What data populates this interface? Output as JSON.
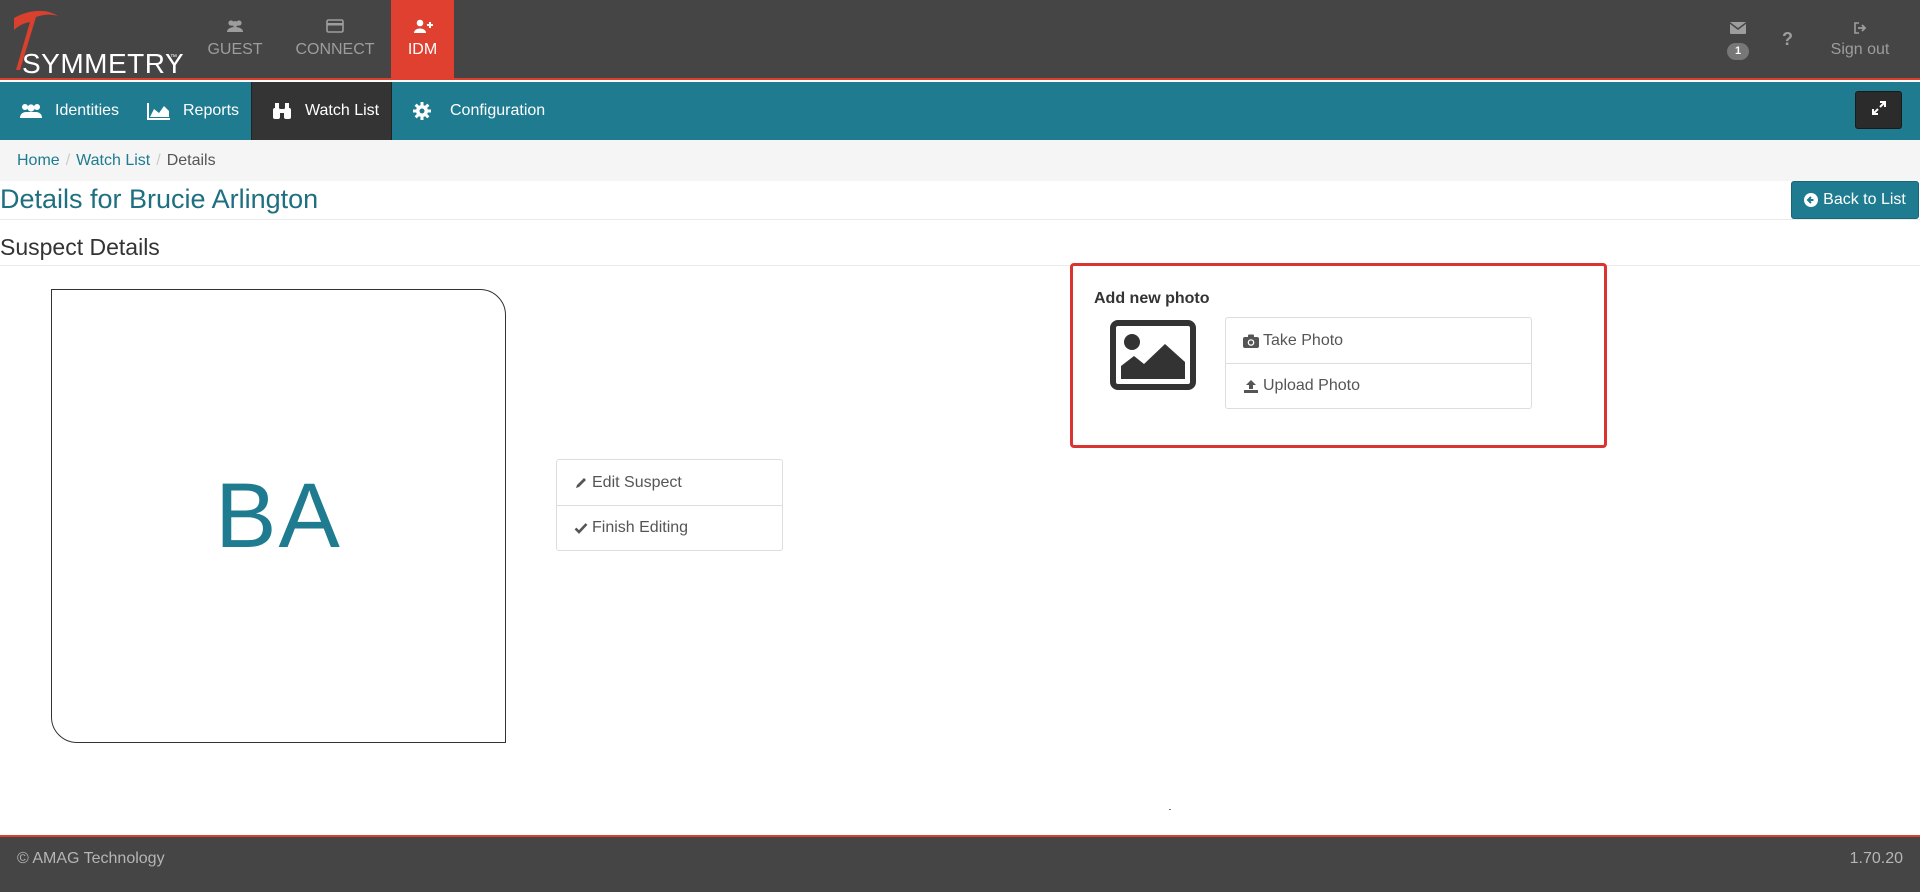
{
  "brand": {
    "logo_text": "SYMMETRY",
    "trademark": "™",
    "accent_color": "#1e7b90",
    "active_module_color": "#e0402f"
  },
  "modules": [
    {
      "label": "GUEST",
      "icon": "users-icon"
    },
    {
      "label": "CONNECT",
      "icon": "card-icon"
    },
    {
      "label": "IDM",
      "icon": "user-plus-icon",
      "active": true
    }
  ],
  "top_right": {
    "messages_icon": "envelope-icon",
    "message_count": "1",
    "help_icon": "question-icon",
    "sign_out_label": "Sign out"
  },
  "nav": {
    "items": [
      {
        "label": "Identities",
        "icon": "users-icon"
      },
      {
        "label": "Reports",
        "icon": "area-chart-icon"
      },
      {
        "label": "Watch List",
        "icon": "binoculars-icon",
        "active": true
      },
      {
        "label": "Configuration",
        "icon": "gear-icon"
      }
    ]
  },
  "breadcrumb": {
    "items": [
      "Home",
      "Watch List"
    ],
    "current": "Details"
  },
  "page": {
    "title": "Details for Brucie Arlington",
    "back_label": "Back to List",
    "section_title": "Suspect Details"
  },
  "suspect": {
    "initials": "BA"
  },
  "actions": {
    "edit_label": "Edit Suspect",
    "finish_label": "Finish Editing"
  },
  "photo": {
    "heading": "Add new photo",
    "take_label": "Take Photo",
    "upload_label": "Upload Photo"
  },
  "footer": {
    "copyright": "© AMAG Technology",
    "version": "1.70.20"
  }
}
